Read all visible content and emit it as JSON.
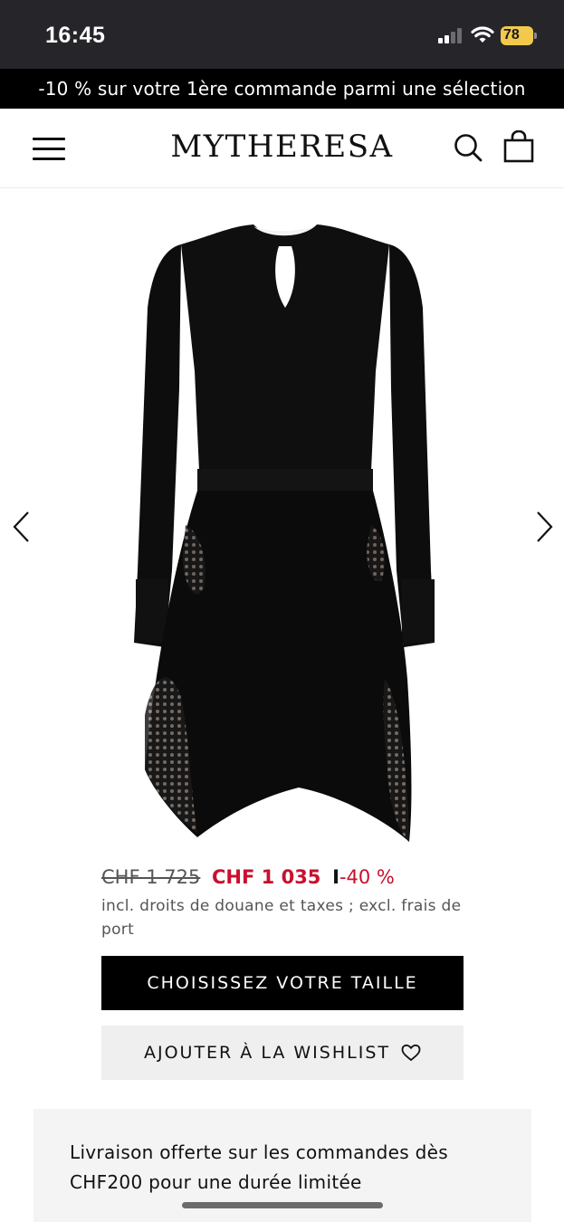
{
  "status_bar": {
    "time": "16:45",
    "battery": "78",
    "icons": [
      "signal-icon",
      "wifi-icon",
      "battery-icon"
    ]
  },
  "promo": {
    "text": "-10 % sur votre 1ère commande parmi une sélection"
  },
  "header": {
    "logo": "MYTHERESA",
    "icons": [
      "menu-icon",
      "search-icon",
      "shopping-bag-icon"
    ]
  },
  "gallery": {
    "icons": [
      "chevron-left-icon",
      "chevron-right-icon"
    ]
  },
  "product": {
    "price_original": "CHF 1 725",
    "price_sale": "CHF 1 035",
    "price_separator": "I",
    "discount": "-40 %",
    "tax_note": "incl. droits de douane et taxes ; excl. frais de port"
  },
  "actions": {
    "choose_size_label": "CHOISISSEZ VOTRE TAILLE",
    "wishlist_label": "AJOUTER À LA WISHLIST",
    "wishlist_icon": "heart-icon"
  },
  "shipping": {
    "text": "Livraison offerte sur les commandes dès CHF200 pour une durée limitée"
  },
  "colors": {
    "sale_red": "#c8102e",
    "status_bar_bg": "#26262a",
    "battery_yellow": "#f2c94c"
  }
}
